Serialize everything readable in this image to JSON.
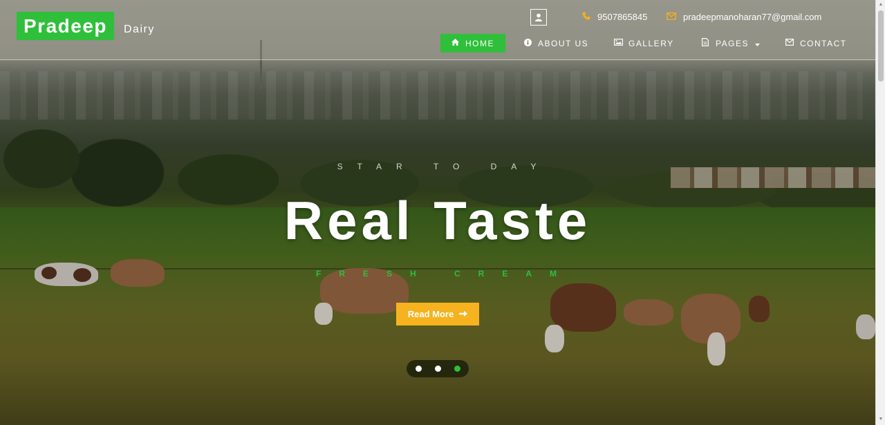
{
  "brand": {
    "name": "Pradeep",
    "suffix": "Dairy"
  },
  "contact": {
    "phone": "9507865845",
    "email": "pradeepmanoharan77@gmail.com"
  },
  "nav": {
    "items": [
      {
        "label": "HOME",
        "icon": "home-icon",
        "active": true
      },
      {
        "label": "ABOUT US",
        "icon": "info-icon",
        "active": false
      },
      {
        "label": "GALLERY",
        "icon": "image-icon",
        "active": false
      },
      {
        "label": "PAGES",
        "icon": "file-icon",
        "active": false,
        "has_dropdown": true
      },
      {
        "label": "CONTACT",
        "icon": "envelope-icon",
        "active": false
      }
    ]
  },
  "hero": {
    "kicker": "STAR TO DAY",
    "headline": "Real Taste",
    "tagline": "FRESH CREAM",
    "cta_label": "Read More",
    "slides": 3,
    "active_slide": 3
  },
  "colors": {
    "accent_green": "#2fbf3a",
    "accent_yellow": "#f6b31f",
    "text_white": "#ffffff"
  }
}
